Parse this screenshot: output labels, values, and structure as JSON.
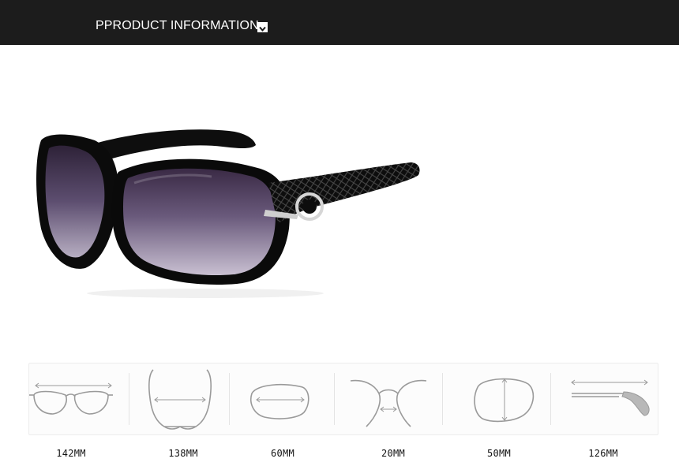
{
  "header": {
    "title": "PPRODUCT INFORMATION",
    "toggle_icon": "chevron-down-icon",
    "background": "#1c1c1c"
  },
  "product_image": {
    "subject": "sunglasses-image"
  },
  "dimensions": [
    {
      "icon": "total-width-icon",
      "value": "142MM"
    },
    {
      "icon": "frame-width-icon",
      "value": "138MM"
    },
    {
      "icon": "lens-width-icon",
      "value": "60MM"
    },
    {
      "icon": "bridge-width-icon",
      "value": "20MM"
    },
    {
      "icon": "lens-height-icon",
      "value": "50MM"
    },
    {
      "icon": "temple-length-icon",
      "value": "126MM"
    }
  ]
}
